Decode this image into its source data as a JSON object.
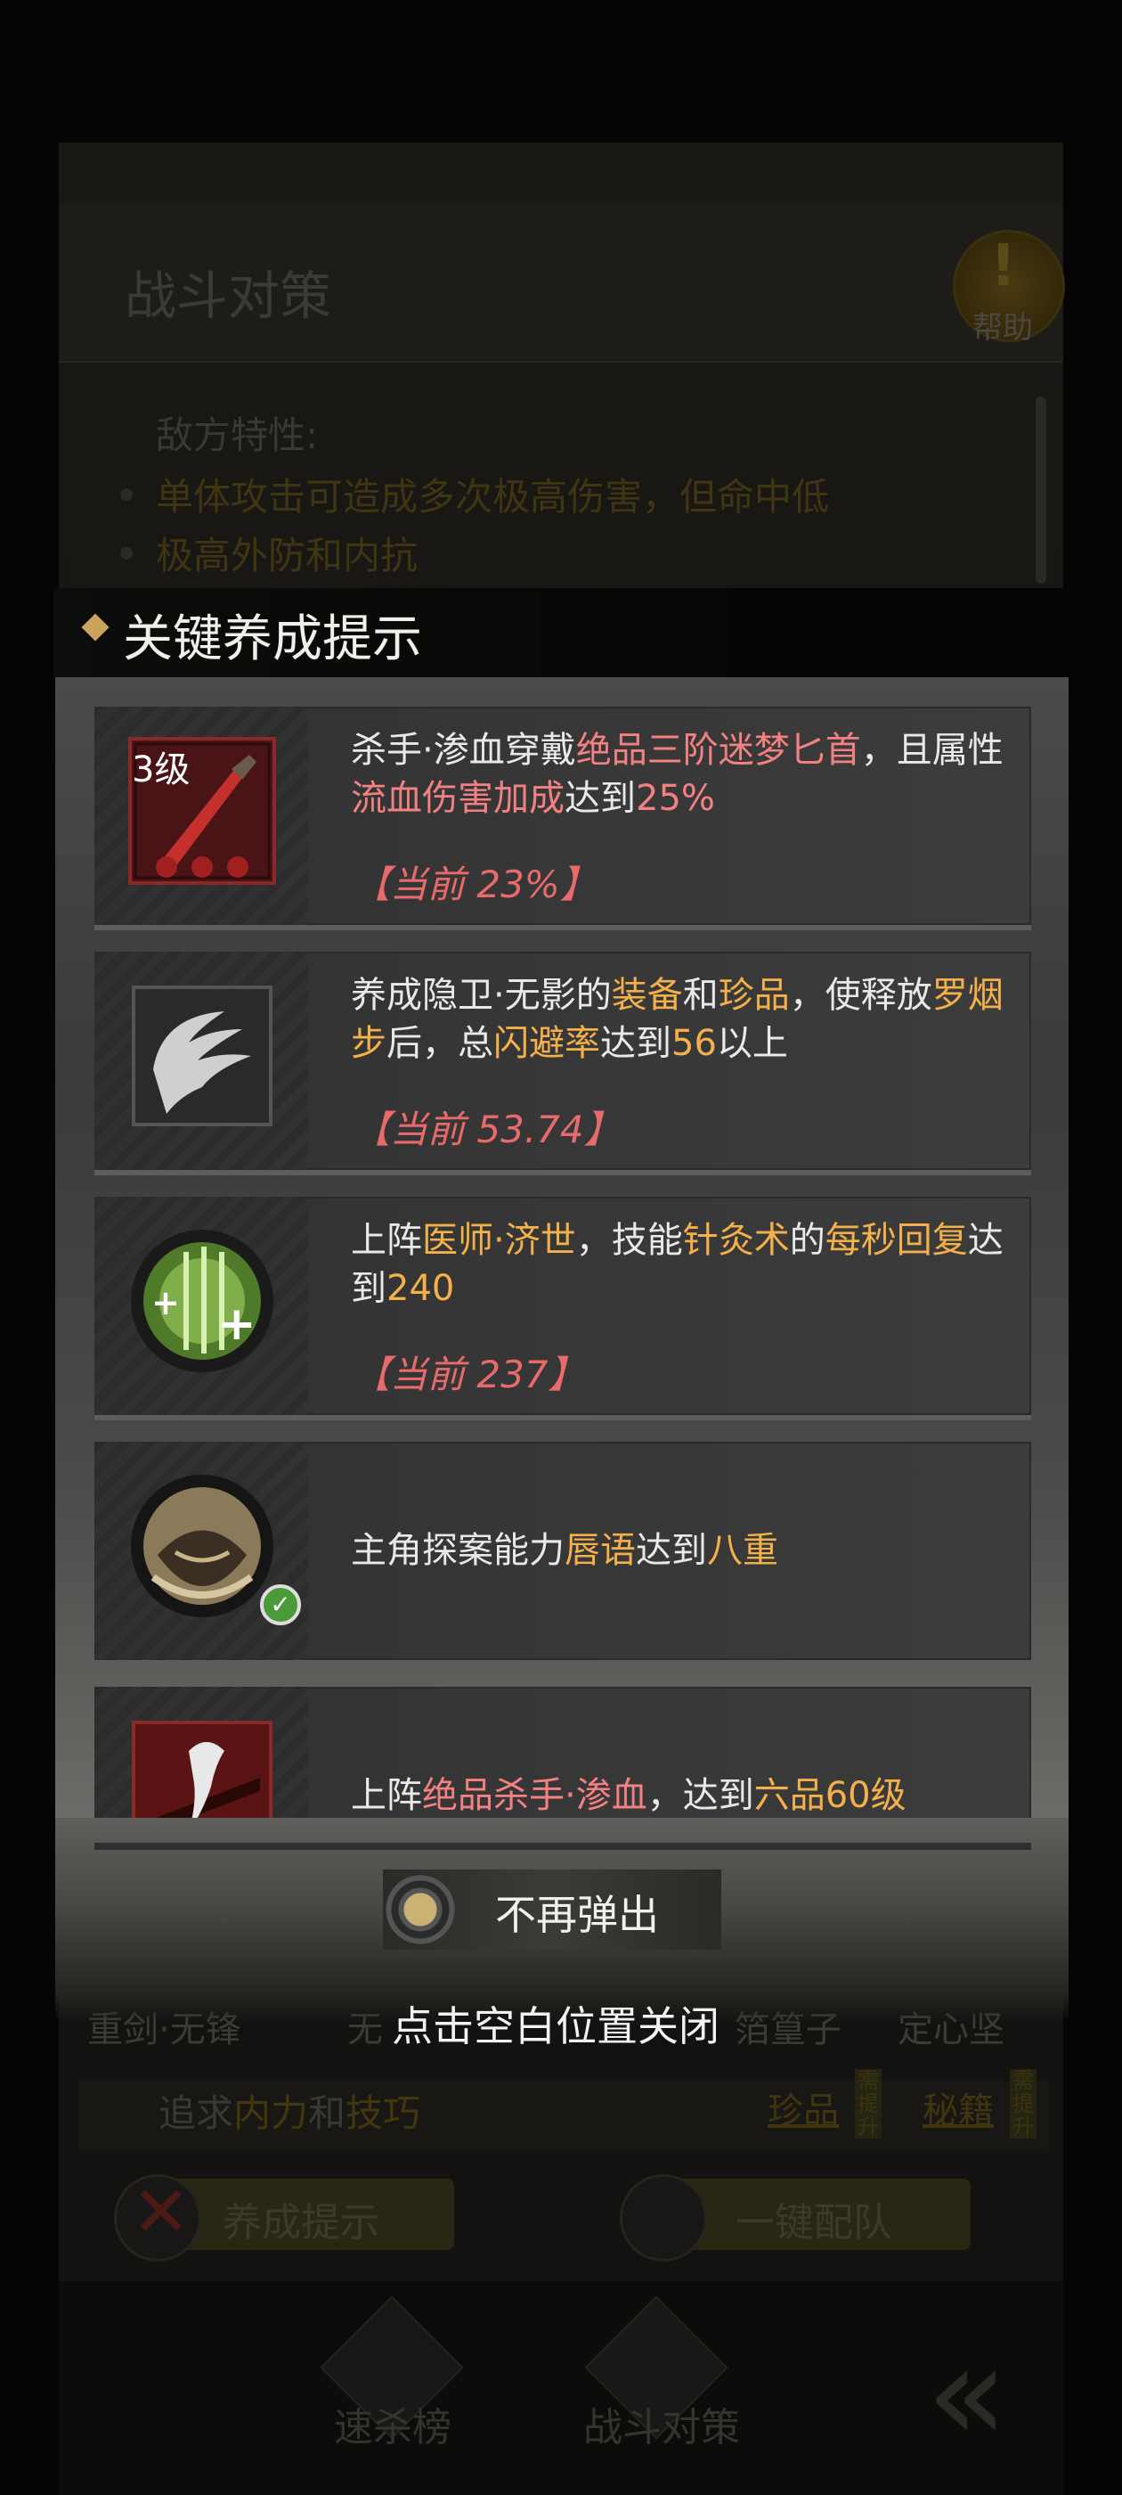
{
  "background": {
    "title": "战斗对策",
    "help_label": "帮助",
    "traits_title": "敌方特性:",
    "traits": [
      "单体攻击可造成多次极高伤害，但命中低",
      "极高外防和内抗"
    ],
    "team_names": [
      "重剑·无锋",
      "无",
      "箔篁子",
      "定心坚"
    ],
    "pursuit_prefix": "追求",
    "pursuit_hl1": "内力",
    "pursuit_mid": "和",
    "pursuit_hl2": "技巧",
    "tags": [
      "珍品",
      "秘籍"
    ],
    "tag_side": "需提升",
    "buttons": [
      "养成提示",
      "一键配队"
    ],
    "nav": [
      "速杀榜",
      "战斗对策"
    ]
  },
  "modal": {
    "title": "关键养成提示",
    "cards": [
      {
        "level": "3级",
        "text": [
          {
            "t": "杀手·渗血穿戴",
            "c": ""
          },
          {
            "t": "绝品三阶迷梦匕首",
            "c": "red"
          },
          {
            "t": "，且属性",
            "c": ""
          },
          {
            "t": "流血伤害加成",
            "c": "red"
          },
          {
            "t": "达到",
            "c": ""
          },
          {
            "t": "25%",
            "c": "red"
          }
        ],
        "current": "【当前 23%】"
      },
      {
        "text": [
          {
            "t": "养成隐卫·无影的",
            "c": ""
          },
          {
            "t": "装备",
            "c": "gold"
          },
          {
            "t": "和",
            "c": ""
          },
          {
            "t": "珍品",
            "c": "gold"
          },
          {
            "t": "，使释放",
            "c": ""
          },
          {
            "t": "罗烟步",
            "c": "gold"
          },
          {
            "t": "后，总",
            "c": ""
          },
          {
            "t": "闪避率",
            "c": "gold"
          },
          {
            "t": "达到",
            "c": ""
          },
          {
            "t": "56",
            "c": "gold"
          },
          {
            "t": "以上",
            "c": ""
          }
        ],
        "current": "【当前 53.74】"
      },
      {
        "text": [
          {
            "t": "上阵",
            "c": ""
          },
          {
            "t": "医师·济世",
            "c": "gold"
          },
          {
            "t": "，技能",
            "c": ""
          },
          {
            "t": "针灸术",
            "c": "gold"
          },
          {
            "t": "的",
            "c": ""
          },
          {
            "t": "每秒回复",
            "c": "gold"
          },
          {
            "t": "达到",
            "c": ""
          },
          {
            "t": "240",
            "c": "gold"
          }
        ],
        "current": "【当前 237】"
      },
      {
        "completed": true,
        "text": [
          {
            "t": "主角探案能力",
            "c": ""
          },
          {
            "t": "唇语",
            "c": "gold"
          },
          {
            "t": "达到",
            "c": ""
          },
          {
            "t": "八重",
            "c": "gold"
          }
        ]
      },
      {
        "text": [
          {
            "t": "上阵",
            "c": ""
          },
          {
            "t": "绝品杀手·渗血",
            "c": "red"
          },
          {
            "t": "，达到",
            "c": ""
          },
          {
            "t": "六品60级",
            "c": "gold"
          }
        ]
      }
    ],
    "toggle_label": "不再弹出",
    "close_hint": "点击空白位置关闭"
  }
}
